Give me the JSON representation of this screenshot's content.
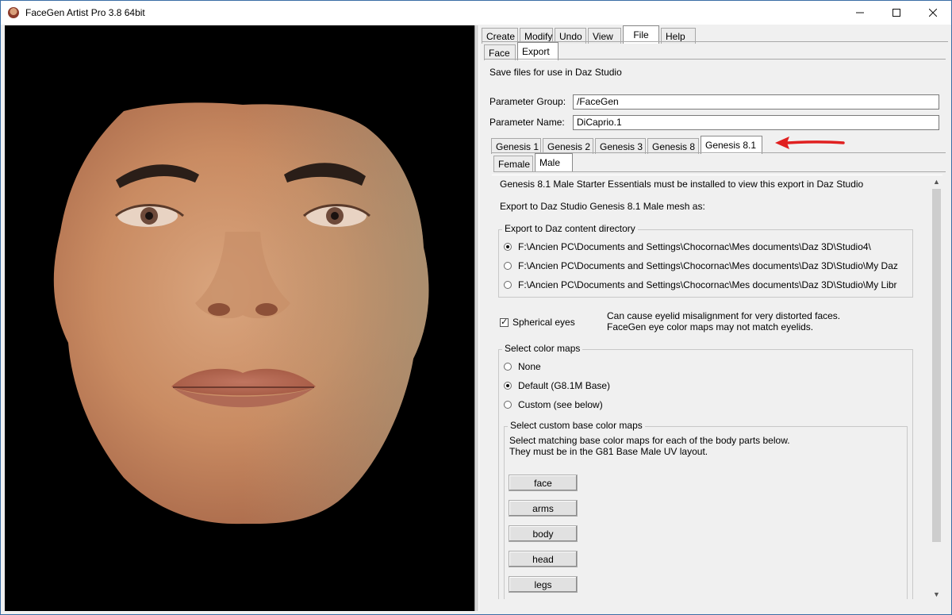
{
  "window": {
    "title": "FaceGen Artist Pro 3.8 64bit",
    "icons": {
      "app": "facegen-app-icon",
      "minimize": "minimize-icon",
      "maximize": "maximize-icon",
      "close": "close-icon"
    }
  },
  "menu_tabs": [
    {
      "label": "Create",
      "active": false
    },
    {
      "label": "Modify",
      "active": false
    },
    {
      "label": "Undo",
      "active": false
    },
    {
      "label": "View",
      "active": false
    },
    {
      "label": "File",
      "active": true
    },
    {
      "label": "Help",
      "active": false
    }
  ],
  "sub_tabs": [
    {
      "label": "Face",
      "active": false
    },
    {
      "label": "Export",
      "active": true
    }
  ],
  "export": {
    "description": "Save files for use in Daz Studio",
    "param_group_label": "Parameter Group:",
    "param_group_value": "/FaceGen",
    "param_name_label": "Parameter Name:",
    "param_name_value": "DiCaprio.1"
  },
  "genesis_tabs": [
    {
      "label": "Genesis 1",
      "active": false
    },
    {
      "label": "Genesis 2",
      "active": false
    },
    {
      "label": "Genesis 3",
      "active": false
    },
    {
      "label": "Genesis 8",
      "active": false
    },
    {
      "label": "Genesis 8.1",
      "active": true
    }
  ],
  "gender_tabs": [
    {
      "label": "Female",
      "active": false
    },
    {
      "label": "Male",
      "active": true
    }
  ],
  "male": {
    "notice": "Genesis 8.1 Male Starter Essentials must be installed to view this export in Daz Studio",
    "export_as": "Export to Daz Studio Genesis 8.1 Male mesh as:",
    "content_dir_title": "Export to Daz content directory",
    "content_dirs": [
      {
        "label": "F:\\Ancien PC\\Documents and Settings\\Chocornac\\Mes documents\\Daz 3D\\Studio4\\",
        "selected": true
      },
      {
        "label": "F:\\Ancien PC\\Documents and Settings\\Chocornac\\Mes documents\\Daz 3D\\Studio\\My Daz",
        "selected": false
      },
      {
        "label": "F:\\Ancien PC\\Documents and Settings\\Chocornac\\Mes documents\\Daz 3D\\Studio\\My Libr",
        "selected": false
      }
    ],
    "spherical_eyes_label": "Spherical eyes",
    "spherical_eyes_checked": true,
    "spherical_note_1": "Can cause eyelid misalignment for very distorted faces.",
    "spherical_note_2": "FaceGen eye color maps may not match eyelids.",
    "color_maps_title": "Select color maps",
    "color_maps": [
      {
        "label": "None",
        "selected": false
      },
      {
        "label": "Default (G8.1M Base)",
        "selected": true
      },
      {
        "label": "Custom (see below)",
        "selected": false
      }
    ],
    "custom_title": "Select custom base color maps",
    "custom_note_1": "Select matching base color maps for each of the body parts below.",
    "custom_note_2": "They must be in the G81 Base Male UV layout.",
    "body_part_buttons": [
      "face",
      "arms",
      "body",
      "head",
      "legs"
    ]
  },
  "annotation": {
    "color": "#e02020",
    "icon": "red-arrow-pointing-left-icon"
  },
  "viewport": {
    "background": "#000000",
    "content": "3D face model render"
  }
}
